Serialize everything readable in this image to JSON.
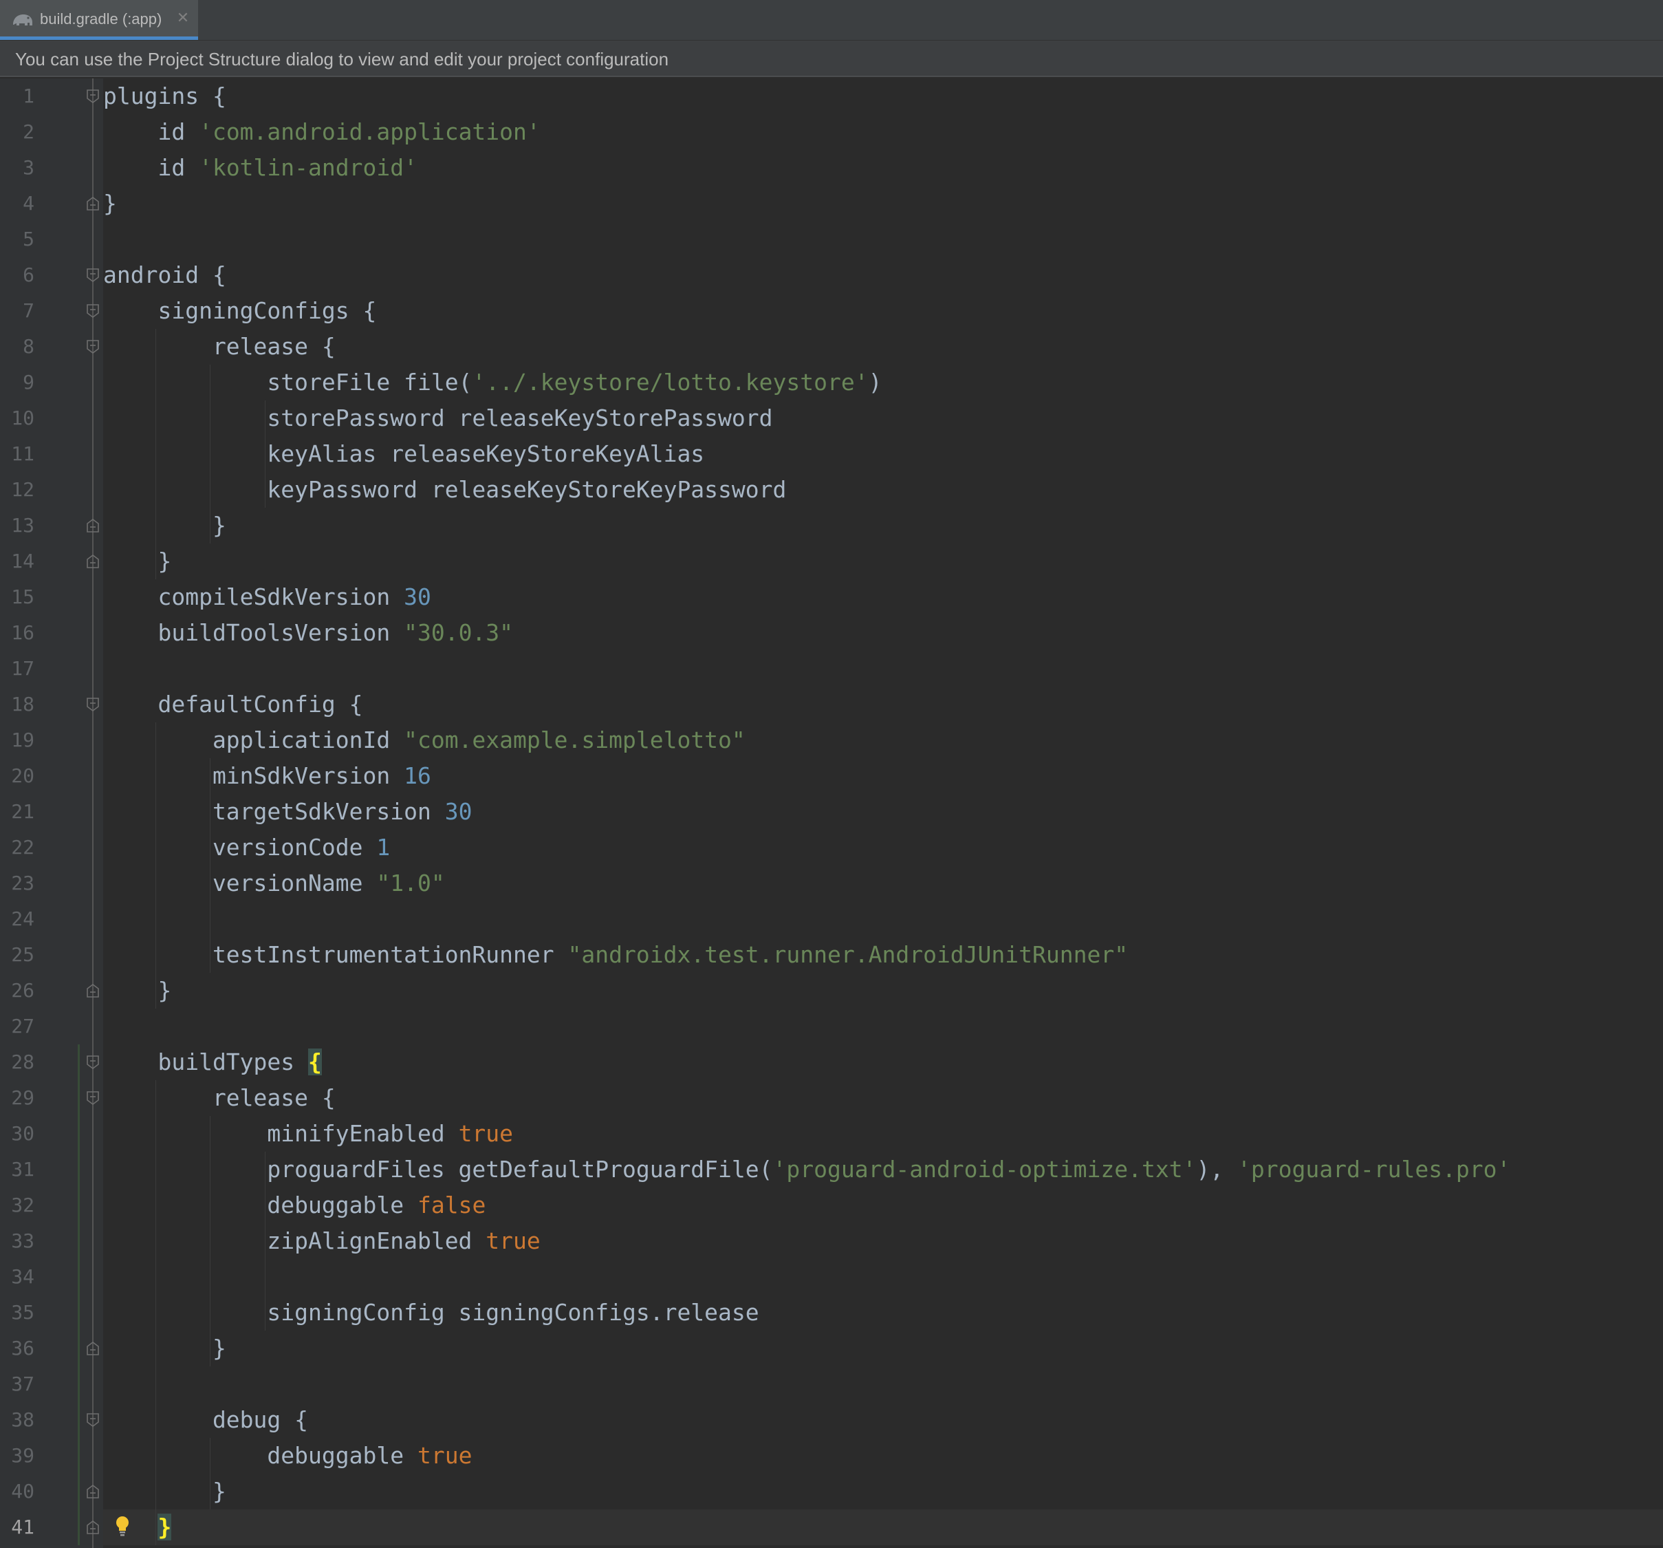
{
  "tab": {
    "title": "build.gradle (:app)",
    "icon": "gradle-elephant-icon",
    "close_glyph": "✕"
  },
  "banner": {
    "text": "You can use the Project Structure dialog to view and edit your project configuration"
  },
  "colors": {
    "editor_background": "#2b2b2b",
    "gutter_background": "#313335",
    "identifier": "#a9b7c6",
    "string": "#6a8759",
    "number": "#6897bb",
    "keyword": "#cc7832",
    "matched_brace": "#ffef28",
    "tab_accent": "#4a88c7"
  },
  "editor": {
    "current_line": 41,
    "lines": [
      {
        "n": "1",
        "tokens": [
          {
            "t": "plugins {"
          }
        ]
      },
      {
        "n": "2",
        "tokens": [
          {
            "t": "    id "
          },
          {
            "t": "'com.android.application'",
            "c": "str"
          }
        ]
      },
      {
        "n": "3",
        "tokens": [
          {
            "t": "    id "
          },
          {
            "t": "'kotlin-android'",
            "c": "str"
          }
        ]
      },
      {
        "n": "4",
        "tokens": [
          {
            "t": "}"
          }
        ]
      },
      {
        "n": "5",
        "tokens": []
      },
      {
        "n": "6",
        "tokens": [
          {
            "t": "android {"
          }
        ]
      },
      {
        "n": "7",
        "tokens": [
          {
            "t": "    signingConfigs {"
          }
        ]
      },
      {
        "n": "8",
        "tokens": [
          {
            "t": "        release {"
          }
        ]
      },
      {
        "n": "9",
        "tokens": [
          {
            "t": "            storeFile file("
          },
          {
            "t": "'../.keystore/lotto.keystore'",
            "c": "str"
          },
          {
            "t": ")"
          }
        ]
      },
      {
        "n": "10",
        "tokens": [
          {
            "t": "            storePassword releaseKeyStorePassword"
          }
        ]
      },
      {
        "n": "11",
        "tokens": [
          {
            "t": "            keyAlias releaseKeyStoreKeyAlias"
          }
        ]
      },
      {
        "n": "12",
        "tokens": [
          {
            "t": "            keyPassword releaseKeyStoreKeyPassword"
          }
        ]
      },
      {
        "n": "13",
        "tokens": [
          {
            "t": "        }"
          }
        ]
      },
      {
        "n": "14",
        "tokens": [
          {
            "t": "    }"
          }
        ]
      },
      {
        "n": "15",
        "tokens": [
          {
            "t": "    compileSdkVersion "
          },
          {
            "t": "30",
            "c": "num"
          }
        ]
      },
      {
        "n": "16",
        "tokens": [
          {
            "t": "    buildToolsVersion "
          },
          {
            "t": "\"30.0.3\"",
            "c": "str"
          }
        ]
      },
      {
        "n": "17",
        "tokens": []
      },
      {
        "n": "18",
        "tokens": [
          {
            "t": "    defaultConfig {"
          }
        ]
      },
      {
        "n": "19",
        "tokens": [
          {
            "t": "        applicationId "
          },
          {
            "t": "\"com.example.simplelotto\"",
            "c": "str"
          }
        ]
      },
      {
        "n": "20",
        "tokens": [
          {
            "t": "        minSdkVersion "
          },
          {
            "t": "16",
            "c": "num"
          }
        ]
      },
      {
        "n": "21",
        "tokens": [
          {
            "t": "        targetSdkVersion "
          },
          {
            "t": "30",
            "c": "num"
          }
        ]
      },
      {
        "n": "22",
        "tokens": [
          {
            "t": "        versionCode "
          },
          {
            "t": "1",
            "c": "num"
          }
        ]
      },
      {
        "n": "23",
        "tokens": [
          {
            "t": "        versionName "
          },
          {
            "t": "\"1.0\"",
            "c": "str"
          }
        ]
      },
      {
        "n": "24",
        "tokens": []
      },
      {
        "n": "25",
        "tokens": [
          {
            "t": "        testInstrumentationRunner "
          },
          {
            "t": "\"androidx.test.runner.AndroidJUnitRunner\"",
            "c": "str"
          }
        ]
      },
      {
        "n": "26",
        "tokens": [
          {
            "t": "    }"
          }
        ]
      },
      {
        "n": "27",
        "tokens": []
      },
      {
        "n": "28",
        "tokens": [
          {
            "t": "    buildTypes "
          },
          {
            "t": "{",
            "c": "brace-match"
          }
        ]
      },
      {
        "n": "29",
        "tokens": [
          {
            "t": "        release {"
          }
        ]
      },
      {
        "n": "30",
        "tokens": [
          {
            "t": "            minifyEnabled "
          },
          {
            "t": "true",
            "c": "kw"
          }
        ]
      },
      {
        "n": "31",
        "tokens": [
          {
            "t": "            proguardFiles getDefaultProguardFile("
          },
          {
            "t": "'proguard-android-optimize.txt'",
            "c": "str"
          },
          {
            "t": "), "
          },
          {
            "t": "'proguard-rules.pro'",
            "c": "str"
          }
        ]
      },
      {
        "n": "32",
        "tokens": [
          {
            "t": "            debuggable "
          },
          {
            "t": "false",
            "c": "kw"
          }
        ]
      },
      {
        "n": "33",
        "tokens": [
          {
            "t": "            zipAlignEnabled "
          },
          {
            "t": "true",
            "c": "kw"
          }
        ]
      },
      {
        "n": "34",
        "tokens": []
      },
      {
        "n": "35",
        "tokens": [
          {
            "t": "            signingConfig signingConfigs.release"
          }
        ]
      },
      {
        "n": "36",
        "tokens": [
          {
            "t": "        }"
          }
        ]
      },
      {
        "n": "37",
        "tokens": []
      },
      {
        "n": "38",
        "tokens": [
          {
            "t": "        debug {"
          }
        ]
      },
      {
        "n": "39",
        "tokens": [
          {
            "t": "            debuggable "
          },
          {
            "t": "true",
            "c": "kw"
          }
        ]
      },
      {
        "n": "40",
        "tokens": [
          {
            "t": "        }"
          }
        ]
      },
      {
        "n": "41",
        "tokens": [
          {
            "t": "    "
          },
          {
            "t": "}",
            "c": "brace-match"
          }
        ]
      }
    ],
    "fold_markers": [
      {
        "line": 1,
        "kind": "open"
      },
      {
        "line": 4,
        "kind": "close"
      },
      {
        "line": 6,
        "kind": "open"
      },
      {
        "line": 7,
        "kind": "open"
      },
      {
        "line": 8,
        "kind": "open"
      },
      {
        "line": 13,
        "kind": "close"
      },
      {
        "line": 14,
        "kind": "close"
      },
      {
        "line": 18,
        "kind": "open"
      },
      {
        "line": 26,
        "kind": "close"
      },
      {
        "line": 28,
        "kind": "open"
      },
      {
        "line": 29,
        "kind": "open"
      },
      {
        "line": 36,
        "kind": "close"
      },
      {
        "line": 38,
        "kind": "open"
      },
      {
        "line": 40,
        "kind": "close"
      },
      {
        "line": 41,
        "kind": "close"
      }
    ],
    "intention_bulb_line": 41,
    "intention_icon": "lightbulb-icon",
    "vcs_changed_lines": [
      28,
      41
    ]
  }
}
